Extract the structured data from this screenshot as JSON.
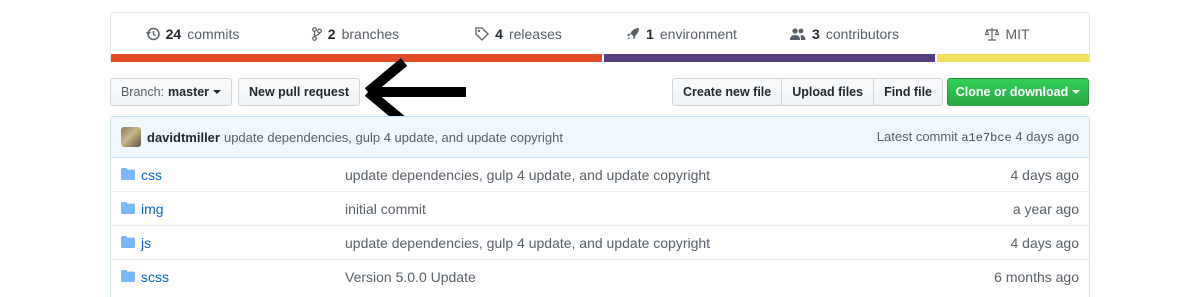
{
  "summary": {
    "commits": {
      "count": "24",
      "label": "commits",
      "icon": "history-icon"
    },
    "branches": {
      "count": "2",
      "label": "branches",
      "icon": "git-branch-icon"
    },
    "releases": {
      "count": "4",
      "label": "releases",
      "icon": "tag-icon"
    },
    "environments": {
      "count": "1",
      "label": "environment",
      "icon": "rocket-icon"
    },
    "contributors": {
      "count": "3",
      "label": "contributors",
      "icon": "people-icon"
    },
    "license": {
      "label": "MIT",
      "icon": "law-icon"
    }
  },
  "language_bar": [
    {
      "color": "#e34c26",
      "fraction": 0.504
    },
    {
      "color": "#563d7c",
      "fraction": 0.34
    },
    {
      "color": "#f1e05a",
      "fraction": 0.156
    }
  ],
  "toolbar": {
    "branch_prefix": "Branch:",
    "branch_name": "master",
    "new_pr_label": "New pull request",
    "create_file_label": "Create new file",
    "upload_files_label": "Upload files",
    "find_file_label": "Find file",
    "clone_label": "Clone or download",
    "annotation_arrow_icon": "left-arrow-icon"
  },
  "latest_commit": {
    "author": "davidtmiller",
    "message": "update dependencies, gulp 4 update, and update copyright",
    "prefix": "Latest commit",
    "sha": "a1e7bce",
    "age": "4 days ago"
  },
  "files": [
    {
      "name": "css",
      "message": "update dependencies, gulp 4 update, and update copyright",
      "age": "4 days ago",
      "icon": "folder-icon"
    },
    {
      "name": "img",
      "message": "initial commit",
      "age": "a year ago",
      "icon": "folder-icon"
    },
    {
      "name": "js",
      "message": "update dependencies, gulp 4 update, and update copyright",
      "age": "4 days ago",
      "icon": "folder-icon"
    },
    {
      "name": "scss",
      "message": "Version 5.0.0 Update",
      "age": "6 months ago",
      "icon": "folder-icon"
    }
  ],
  "colors": {
    "link": "#0366d6",
    "green_button": "#28a745",
    "commit_bar_bg": "#f1f8ff",
    "folder": "#79b8ff"
  }
}
